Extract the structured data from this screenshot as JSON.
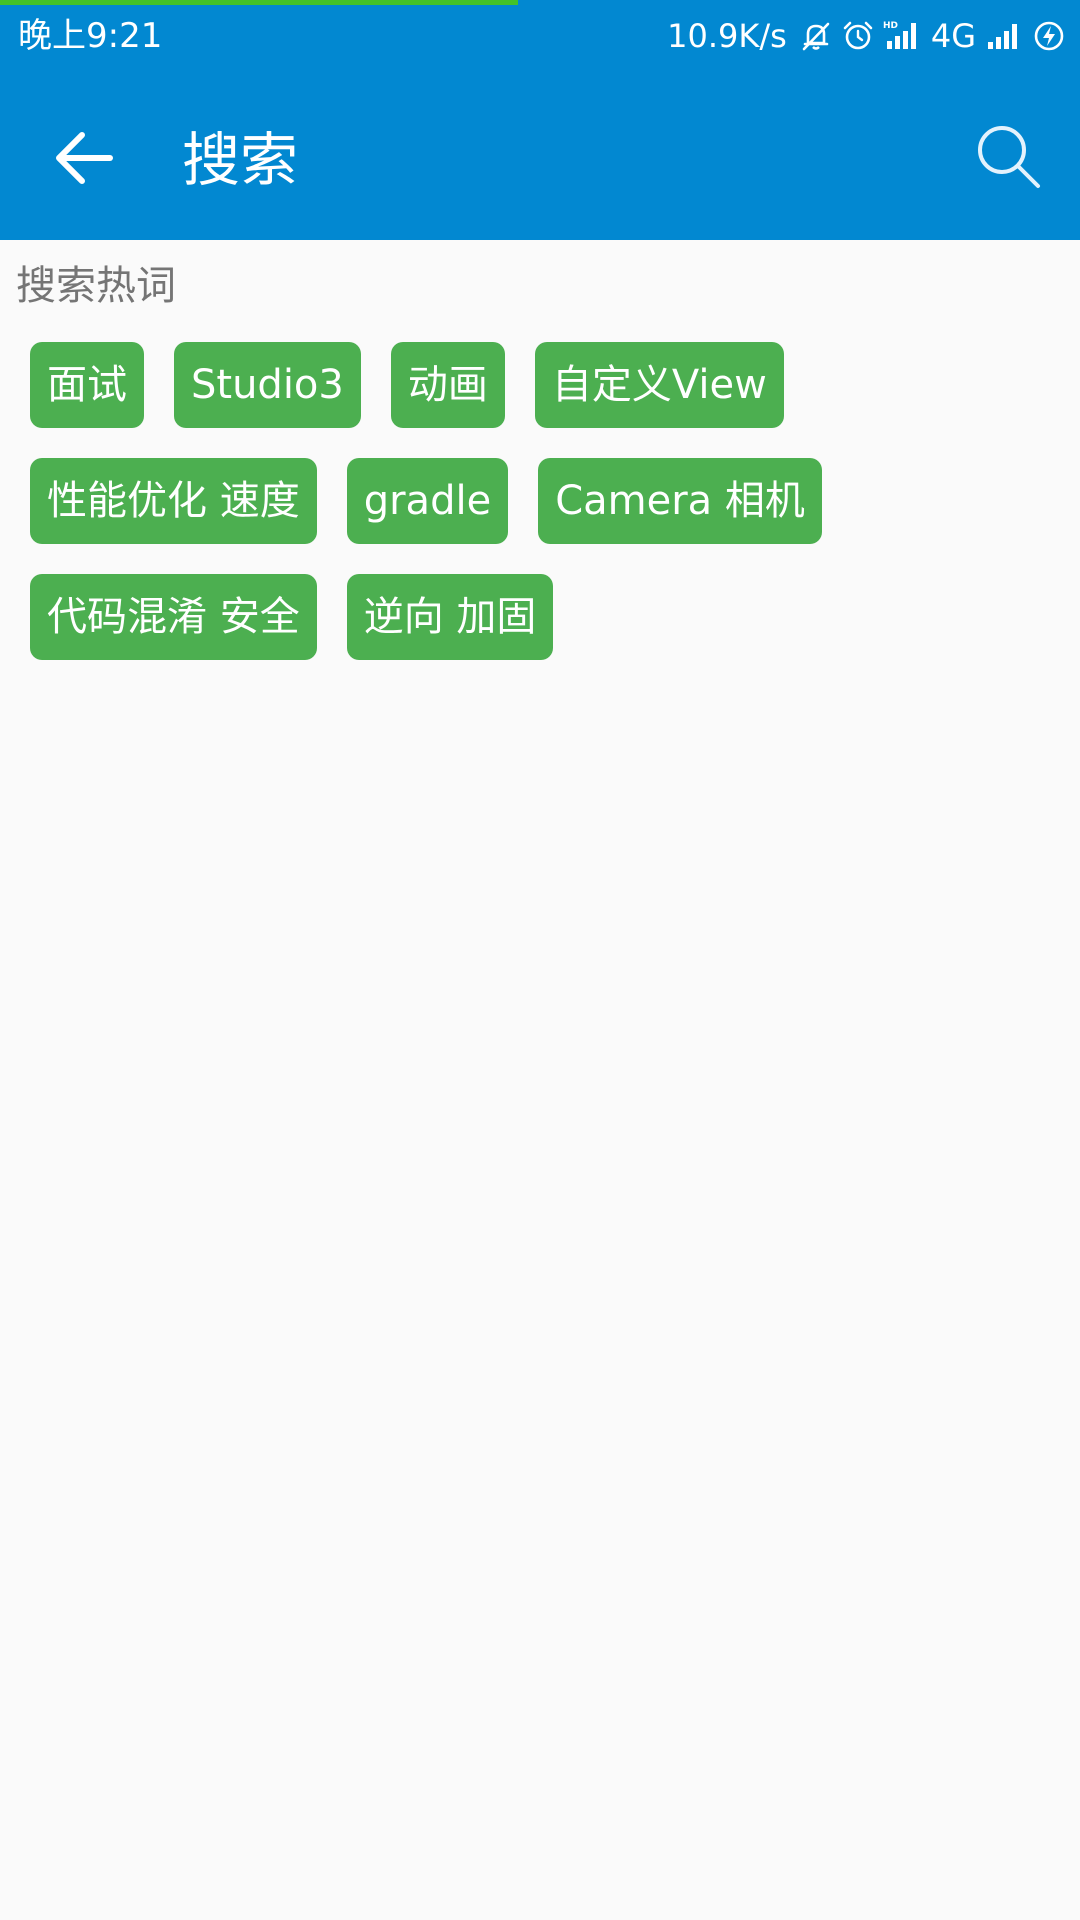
{
  "status_bar": {
    "time": "晚上9:21",
    "net_speed": "10.9K/s",
    "network_type": "4G",
    "page_load_progress": 0.48,
    "icons": [
      "mute-bell-icon",
      "alarm-clock-icon",
      "hd-signal-icon",
      "signal-icon",
      "charging-battery-icon"
    ]
  },
  "app_bar": {
    "title": "搜索",
    "icons": [
      "arrow-left-icon",
      "search-icon"
    ]
  },
  "hot_words": {
    "title": "搜索热词",
    "tags": [
      "面试",
      "Studio3",
      "动画",
      "自定义View",
      "性能优化 速度",
      "gradle",
      "Camera 相机",
      "代码混淆 安全",
      "逆向 加固"
    ]
  },
  "colors": {
    "primary": "#0288d1",
    "tag_background": "#4caf50",
    "progress": "#43c22a",
    "section_title": "#757575",
    "background": "#fafafa"
  }
}
